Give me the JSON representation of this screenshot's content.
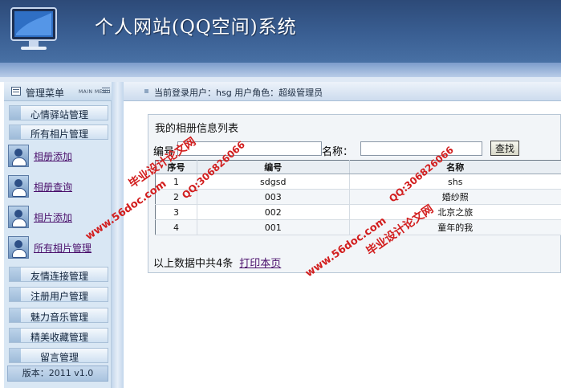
{
  "header": {
    "title": "个人网站(QQ空间)系统"
  },
  "sidebar": {
    "menu_title": "管理菜单",
    "menu_subtitle": "MAIN MENU",
    "items": [
      {
        "label": "心情驿站管理"
      },
      {
        "label": "所有相片管理"
      },
      {
        "label": "相册添加",
        "icon": "user-icon"
      },
      {
        "label": "相册查询",
        "icon": "user-icon"
      },
      {
        "label": "相片添加",
        "icon": "user-icon"
      },
      {
        "label": "所有相片管理",
        "icon": "user-icon"
      },
      {
        "label": "友情连接管理"
      },
      {
        "label": "注册用户管理"
      },
      {
        "label": "魅力音乐管理"
      },
      {
        "label": "精美收藏管理"
      },
      {
        "label": "留言管理"
      }
    ],
    "version": "版本：2011 v1.0"
  },
  "infobar": {
    "text": "当前登录用户：hsg  用户角色：超级管理员"
  },
  "panel": {
    "title": "我的相册信息列表",
    "search": {
      "label1": "编号",
      "value1": "",
      "label2": "名称：",
      "value2": "",
      "button": "查找"
    },
    "columns": [
      "序号",
      "编号",
      "名称"
    ],
    "rows": [
      [
        "1",
        "sdgsd",
        "shs"
      ],
      [
        "2",
        "003",
        "婚纱照"
      ],
      [
        "3",
        "002",
        "北京之旅"
      ],
      [
        "4",
        "001",
        "童年的我"
      ]
    ],
    "footer_text": "以上数据中共4条",
    "print_link": "打印本页"
  },
  "watermarks": {
    "text1": "毕业设计论文网",
    "text2": "www.56doc.com",
    "text3": "QQ:306826066"
  },
  "colors": {
    "header": "#3a5f93",
    "sidebar": "#d9e7f4",
    "link": "#4a0f6b",
    "watermark": "#d21e1e"
  }
}
